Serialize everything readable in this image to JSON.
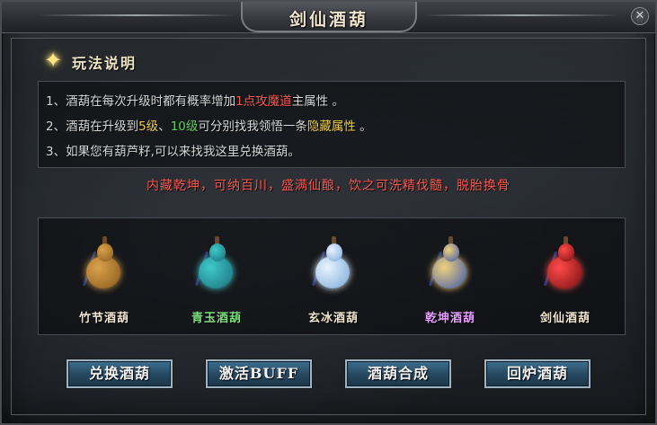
{
  "window": {
    "title": "剑仙酒葫",
    "close_symbol": "✕"
  },
  "rules": {
    "heading": "玩法说明",
    "lines": [
      {
        "num": "1、",
        "parts": [
          "酒葫在每次升级时都有概率增加",
          "1点攻魔道",
          "主属性 。"
        ]
      },
      {
        "num": "2、",
        "parts": [
          "酒葫在升级到",
          "5级",
          "、",
          "10级",
          "可分别找我领悟一条",
          "隐藏属性",
          " 。"
        ]
      },
      {
        "num": "3、",
        "parts": [
          "如果您有葫芦籽,可以来找我这里兑换酒葫。"
        ]
      }
    ]
  },
  "slogan": "内藏乾坤，可纳百川，盛满仙酿，饮之可洗精伐髓，脱胎换骨",
  "items": [
    {
      "name": "竹节酒葫",
      "label_color": "#f0e6cf",
      "gourd_color": "#d9a24a",
      "gourd_dark": "#8a5a1e",
      "icon": "bamboo-gourd-icon"
    },
    {
      "name": "青玉酒葫",
      "label_color": "#7fe07f",
      "gourd_color": "#3fc9c9",
      "gourd_dark": "#1a6f7a",
      "icon": "jade-gourd-icon"
    },
    {
      "name": "玄冰酒葫",
      "label_color": "#f0e6cf",
      "gourd_color": "#e8f4ff",
      "gourd_dark": "#7aa8d8",
      "icon": "ice-gourd-icon"
    },
    {
      "name": "乾坤酒葫",
      "label_color": "#e6a0ff",
      "gourd_color": "#f0d27a",
      "gourd_dark": "#3a56b0",
      "icon": "qiankun-gourd-icon"
    },
    {
      "name": "剑仙酒葫",
      "label_color": "#f0e6cf",
      "gourd_color": "#ff4a4a",
      "gourd_dark": "#7a1010",
      "icon": "sword-immortal-gourd-icon"
    }
  ],
  "buttons": {
    "exchange": "兑换酒葫",
    "activate": "激活BUFF",
    "combine": "酒葫合成",
    "recycle": "回炉酒葫"
  }
}
